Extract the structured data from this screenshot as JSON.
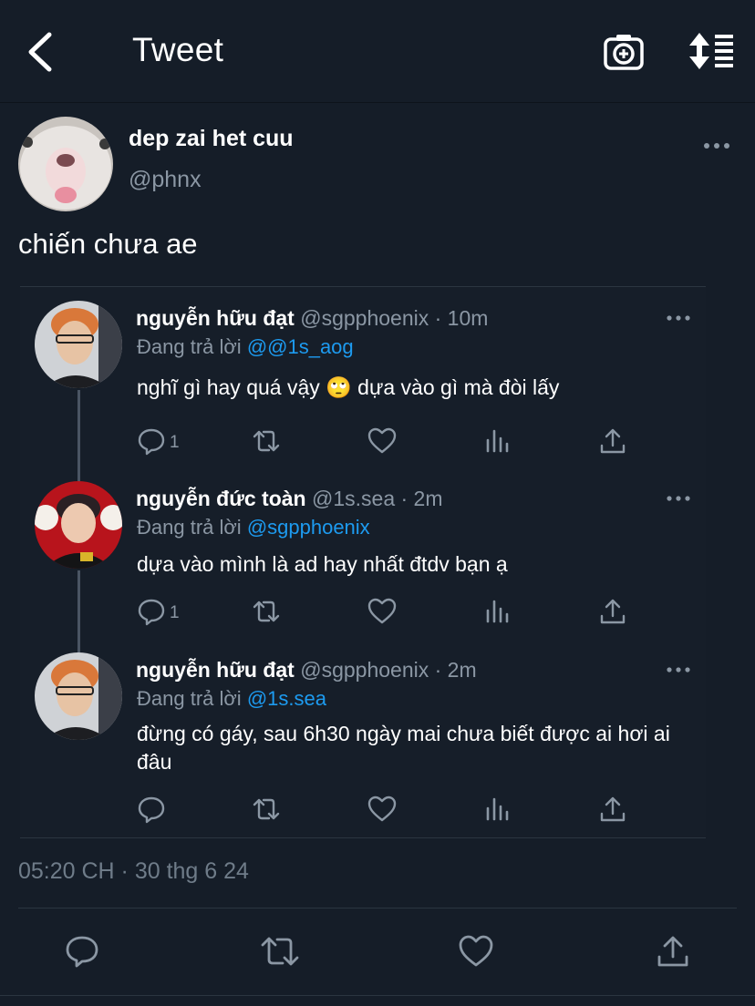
{
  "header": {
    "title": "Tweet",
    "back_icon": "chevron-left-icon",
    "camera_icon": "camera-plus-icon",
    "sort_icon": "sort-list-icon"
  },
  "tweet": {
    "author_name": "dep zai het cuu",
    "author_handle": "@phnx",
    "text": "chiến chưa ae",
    "timestamp": "05:20 CH · 30 thg 6 24"
  },
  "replies": [
    {
      "name": "nguyễn hữu đạt",
      "meta": " @sgpphoenix · 10m",
      "replying_prefix": "Đang trả lời ",
      "replying_to": "@@1s_aog",
      "text": "nghĩ gì hay quá vậy 🙄 dựa vào gì mà đòi lấy",
      "reply_count": "1"
    },
    {
      "name": "nguyễn đức toàn",
      "meta": " @1s.sea · 2m",
      "replying_prefix": "Đang trả lời ",
      "replying_to": "@sgpphoenix",
      "text": "dựa vào mình là ad hay nhất đtdv bạn ạ",
      "reply_count": "1"
    },
    {
      "name": "nguyễn hữu đạt",
      "meta": " @sgpphoenix · 2m",
      "replying_prefix": "Đang trả lời ",
      "replying_to": "@1s.sea",
      "text": "đừng có gáy, sau 6h30 ngày mai chưa biết được ai hơi ai đâu",
      "reply_count": ""
    }
  ],
  "colors": {
    "background": "#151d28",
    "accent": "#1d9bf0",
    "muted": "#8b97a4"
  }
}
